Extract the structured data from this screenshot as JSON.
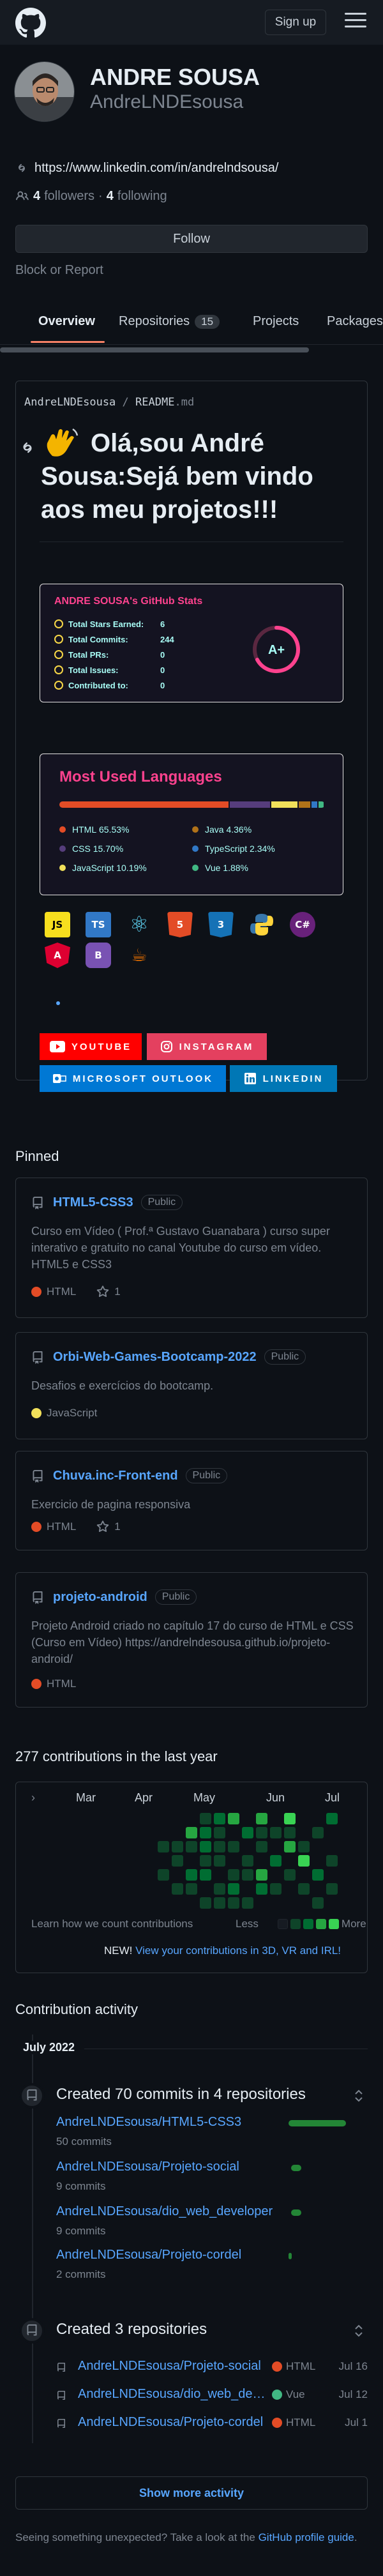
{
  "header": {
    "signup_label": "Sign up"
  },
  "profile": {
    "name": "ANDRE SOUSA",
    "login": "AndreLNDEsousa",
    "website": "https://www.linkedin.com/in/andrelndsousa/",
    "followers_count": "4",
    "followers_label": "followers",
    "separator": "·",
    "following_count": "4",
    "following_label": "following",
    "follow_label": "Follow",
    "block_label": "Block or Report"
  },
  "tabs": [
    {
      "label": "Overview"
    },
    {
      "label": "Repositories",
      "count": "15"
    },
    {
      "label": "Projects"
    },
    {
      "label": "Packages"
    }
  ],
  "readme": {
    "owner": "AndreLNDEsousa",
    "sep": "/",
    "file": "README",
    "ext": ".md",
    "heading": "Olá,sou André Sousa:Sejá bem vindo aos meu projetos!!!",
    "stats": {
      "title": "ANDRE SOUSA's GitHub Stats",
      "rows": [
        {
          "label": "Total Stars Earned:",
          "value": "6"
        },
        {
          "label": "Total Commits:",
          "value": "244"
        },
        {
          "label": "Total PRs:",
          "value": "0"
        },
        {
          "label": "Total Issues:",
          "value": "0"
        },
        {
          "label": "Contributed to:",
          "value": "0"
        }
      ],
      "rank": "A+",
      "accent": "#fe428e",
      "text_color": "#a9fef7",
      "icon_color": "#f8d847"
    },
    "languages": {
      "title": "Most Used Languages",
      "items": [
        {
          "name": "HTML",
          "pct": "65.53%",
          "share": 65.53,
          "color": "#e34c26"
        },
        {
          "name": "CSS",
          "pct": "15.70%",
          "share": 15.7,
          "color": "#563d7c"
        },
        {
          "name": "JavaScript",
          "pct": "10.19%",
          "share": 10.19,
          "color": "#f1e05a"
        },
        {
          "name": "Java",
          "pct": "4.36%",
          "share": 4.36,
          "color": "#b07219"
        },
        {
          "name": "TypeScript",
          "pct": "2.34%",
          "share": 2.34,
          "color": "#3178c6"
        },
        {
          "name": "Vue",
          "pct": "1.88%",
          "share": 1.88,
          "color": "#41b883"
        }
      ]
    },
    "tech_icons": [
      {
        "name": "js-icon",
        "text": "JS"
      },
      {
        "name": "ts-icon",
        "text": "TS"
      },
      {
        "name": "react-icon",
        "text": "⚛"
      },
      {
        "name": "html5-icon",
        "text": "5"
      },
      {
        "name": "css3-icon",
        "text": "3"
      },
      {
        "name": "python-icon",
        "text": ""
      },
      {
        "name": "csharp-icon",
        "text": "C#"
      },
      {
        "name": "angular-icon",
        "text": "A"
      },
      {
        "name": "bootstrap-icon",
        "text": "B"
      },
      {
        "name": "java-icon",
        "text": "☕"
      }
    ],
    "badges": [
      {
        "label": "YOUTUBE",
        "color": "#ff0000"
      },
      {
        "label": "INSTAGRAM",
        "color": "#e4405f"
      },
      {
        "label": "MICROSOFT OUTLOOK",
        "color": "#0078d4"
      },
      {
        "label": "LINKEDIN",
        "color": "#0077b5"
      }
    ]
  },
  "pinned": {
    "title": "Pinned",
    "visibility_label": "Public",
    "items": [
      {
        "name": "HTML5-CSS3",
        "desc": "Curso em Vídeo ( Prof.ª Gustavo Guanabara ) curso super interativo e gratuito no canal Youtube do curso em vídeo. HTML5 e CSS3",
        "lang": "HTML",
        "lang_color": "#e34c26",
        "stars": "1"
      },
      {
        "name": "Orbi-Web-Games-Bootcamp-2022",
        "desc": "Desafios e exercícios do bootcamp.",
        "lang": "JavaScript",
        "lang_color": "#f1e05a",
        "stars": ""
      },
      {
        "name": "Chuva.inc-Front-end",
        "desc": "Exercicio de pagina responsiva",
        "lang": "HTML",
        "lang_color": "#e34c26",
        "stars": "1"
      },
      {
        "name": "projeto-android",
        "desc": "Projeto Android criado no capítulo 17 do curso de HTML e CSS (Curso em Vídeo) https://andrelndesousa.github.io/projeto-android/",
        "lang": "HTML",
        "lang_color": "#e34c26",
        "stars": ""
      }
    ]
  },
  "contributions": {
    "title": "277 contributions in the last year",
    "months": [
      "Mar",
      "Apr",
      "May",
      "Jun",
      "Jul"
    ],
    "learn_label": "Learn how we count contributions",
    "less_label": "Less",
    "more_label": "More",
    "new_label": "NEW!",
    "new_link": "View your contributions in 3D, VR and IRL!",
    "legend_colors": [
      "#161b22",
      "#0e4429",
      "#006d32",
      "#26a641",
      "#39d353"
    ]
  },
  "activity": {
    "title": "Contribution activity",
    "month": "July 2022",
    "commits_title": "Created 70 commits in 4 repositories",
    "commit_repos": [
      {
        "name": "AndreLNDEsousa/HTML5-CSS3",
        "commits": "50 commits",
        "share": 50
      },
      {
        "name": "AndreLNDEsousa/Projeto-social",
        "commits": "9 commits",
        "share": 9
      },
      {
        "name": "AndreLNDEsousa/dio_web_developer",
        "commits": "9 commits",
        "share": 9
      },
      {
        "name": "AndreLNDEsousa/Projeto-cordel",
        "commits": "2 commits",
        "share": 2
      }
    ],
    "repos_title": "Created 3 repositories",
    "created_repos": [
      {
        "name": "AndreLNDEsousa/Projeto-social",
        "lang": "HTML",
        "lang_color": "#e34c26",
        "date": "Jul 16"
      },
      {
        "name": "AndreLNDEsousa/dio_web_developer",
        "lang": "Vue",
        "lang_color": "#41b883",
        "date": "Jul 12"
      },
      {
        "name": "AndreLNDEsousa/Projeto-cordel",
        "lang": "HTML",
        "lang_color": "#e34c26",
        "date": "Jul 1"
      }
    ],
    "show_more": "Show more activity",
    "footnote_prefix": "Seeing something unexpected? Take a look at the ",
    "footnote_link": "GitHub profile guide",
    "footnote_suffix": "."
  }
}
